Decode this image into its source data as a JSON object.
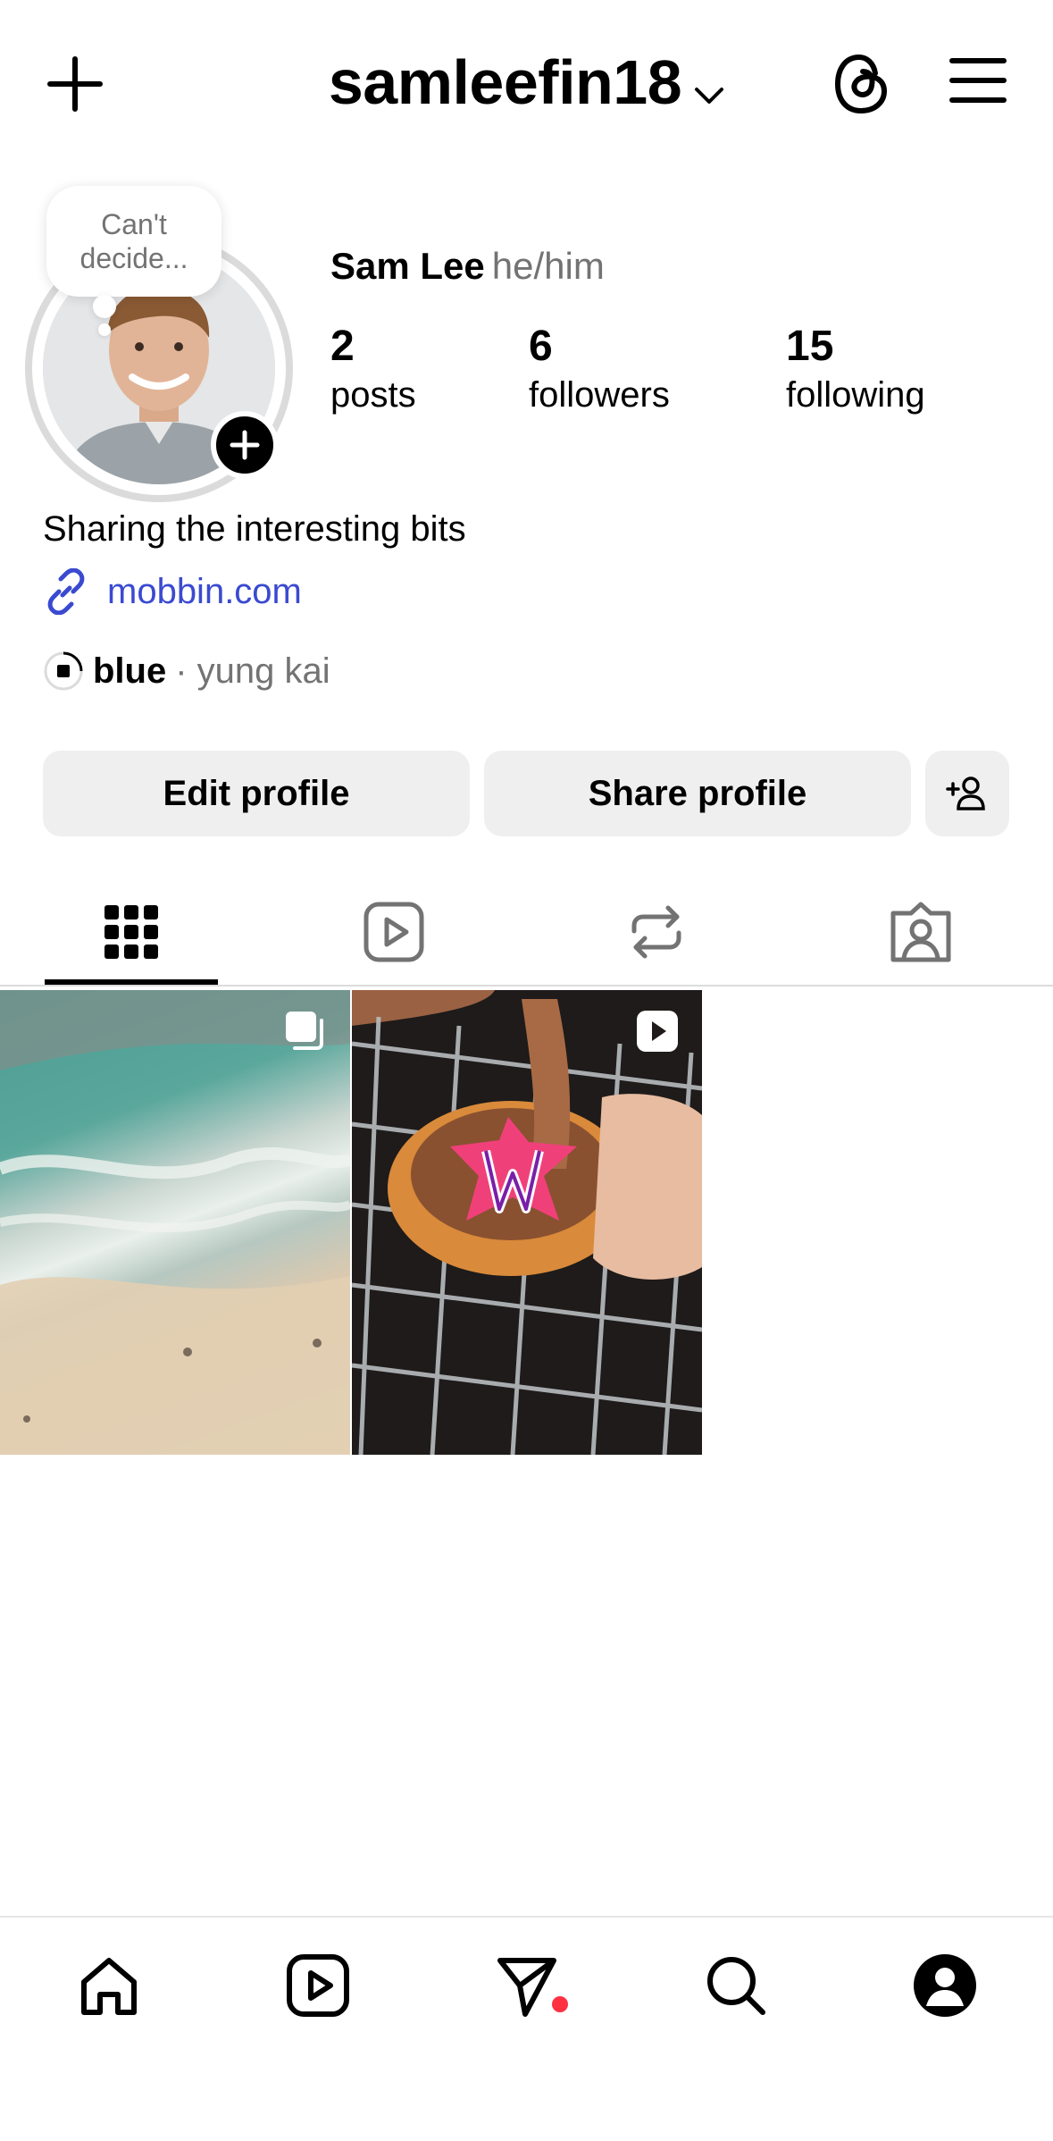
{
  "header": {
    "username": "samleefin18"
  },
  "note": {
    "text_line1": "Can't",
    "text_line2": "decide..."
  },
  "profile": {
    "name": "Sam Lee",
    "pronouns": "he/him",
    "stats": [
      {
        "value": "2",
        "label": "posts"
      },
      {
        "value": "6",
        "label": "followers"
      },
      {
        "value": "15",
        "label": "following"
      }
    ],
    "bio": "Sharing the interesting bits",
    "link": "mobbin.com",
    "music": {
      "song": "blue",
      "artist": "· yung kai"
    }
  },
  "actions": {
    "edit": "Edit profile",
    "share": "Share profile"
  },
  "tabs": [
    "grid-icon",
    "reels-icon",
    "reposts-icon",
    "tagged-icon"
  ],
  "colors": {
    "link": "#3a4ad0",
    "notification_dot": "#ff3040",
    "button_bg": "#efefef"
  }
}
